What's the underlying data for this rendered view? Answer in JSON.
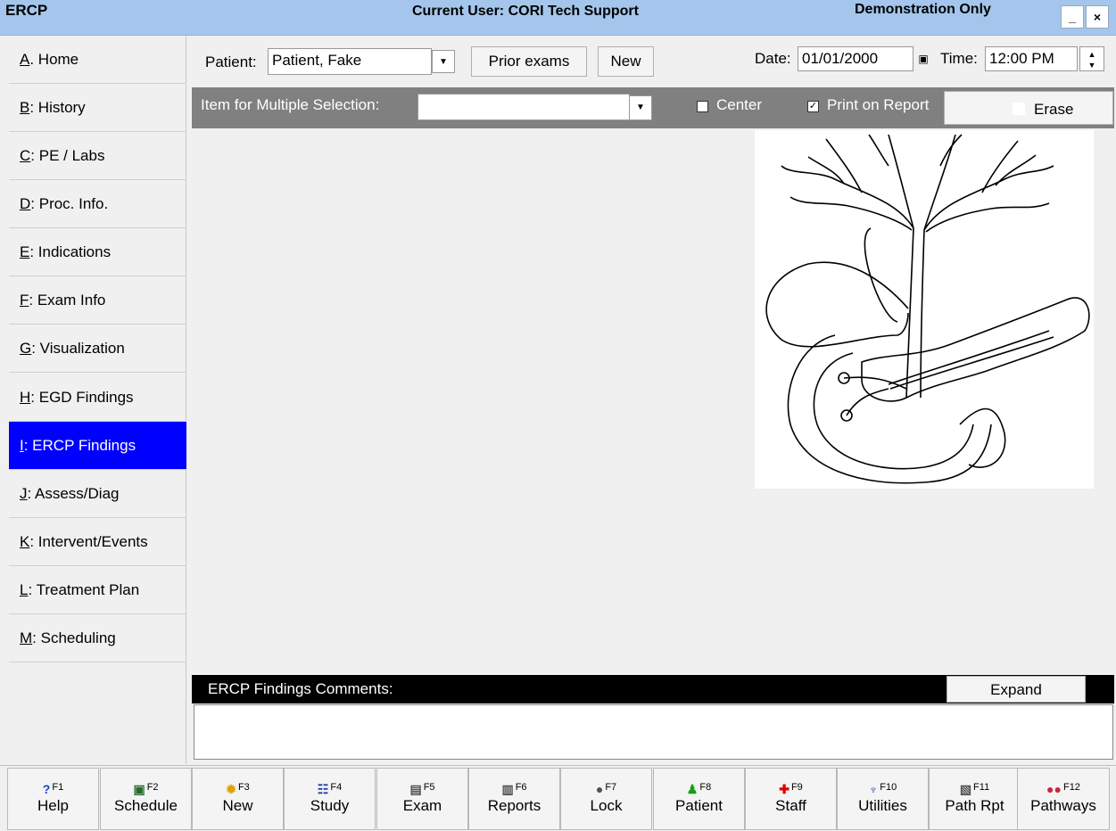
{
  "window": {
    "title": "ERCP",
    "current_user": "Current User: CORI Tech Support",
    "mode": "Demonstration Only",
    "minimize_label": "_",
    "close_label": "×"
  },
  "sidebar": {
    "items": [
      {
        "key": "A",
        "rest": ". Home"
      },
      {
        "key": "B",
        "rest": ": History"
      },
      {
        "key": "C",
        "rest": ": PE / Labs"
      },
      {
        "key": "D",
        "rest": ": Proc. Info."
      },
      {
        "key": "E",
        "rest": ": Indications"
      },
      {
        "key": "F",
        "rest": ": Exam Info"
      },
      {
        "key": "G",
        "rest": ": Visualization"
      },
      {
        "key": "H",
        "rest": ": EGD Findings"
      },
      {
        "key": "I",
        "rest": ": ERCP Findings"
      },
      {
        "key": "J",
        "rest": ": Assess/Diag"
      },
      {
        "key": "K",
        "rest": ": Intervent/Events"
      },
      {
        "key": "L",
        "rest": ": Treatment Plan"
      },
      {
        "key": "M",
        "rest": ": Scheduling"
      }
    ],
    "active_index": 8
  },
  "patient_row": {
    "patient_label": "Patient:",
    "patient_value": "Patient, Fake",
    "prior_exams_label": "Prior exams",
    "new_label": "New",
    "date_label": "Date:",
    "date_value": "01/01/2000",
    "time_label": "Time:",
    "time_value": "12:00 PM"
  },
  "selection_bar": {
    "label": "Item for Multiple Selection:",
    "value": "",
    "center_label": "Center",
    "center_checked": false,
    "print_label": "Print on Report",
    "print_checked": true,
    "erase_label": "Erase"
  },
  "comments": {
    "title": "ERCP Findings Comments:",
    "expand_label": "Expand",
    "value": ""
  },
  "function_keys": [
    {
      "key": "F1",
      "label": "Help",
      "icon": "help-icon",
      "color": "#1a3fc8"
    },
    {
      "key": "F2",
      "label": "Schedule",
      "icon": "schedule-icon",
      "color": "#2a6a2a"
    },
    {
      "key": "F3",
      "label": "New",
      "icon": "new-icon",
      "color": "#e0a000"
    },
    {
      "key": "F4",
      "label": "Study",
      "icon": "study-icon",
      "color": "#2040a0"
    },
    {
      "key": "F5",
      "label": "Exam",
      "icon": "exam-icon",
      "color": "#505050"
    },
    {
      "key": "F6",
      "label": "Reports",
      "icon": "reports-icon",
      "color": "#505050"
    },
    {
      "key": "F7",
      "label": "Lock",
      "icon": "lock-icon",
      "color": "#505050"
    },
    {
      "key": "F8",
      "label": "Patient",
      "icon": "patient-icon",
      "color": "#10a010"
    },
    {
      "key": "F9",
      "label": "Staff",
      "icon": "staff-icon",
      "color": "#e00000"
    },
    {
      "key": "F10",
      "label": "Utilities",
      "icon": "utilities-icon",
      "color": "#2050c0"
    },
    {
      "key": "F11",
      "label": "Path Rpt",
      "icon": "path-report-icon",
      "color": "#505050"
    },
    {
      "key": "F12",
      "label": "Pathways",
      "icon": "pathways-icon",
      "color": "#d02040"
    }
  ],
  "colors": {
    "titlebar": "#a4c6ec",
    "active_nav": "#0000ff",
    "selection_bar": "#808080"
  }
}
